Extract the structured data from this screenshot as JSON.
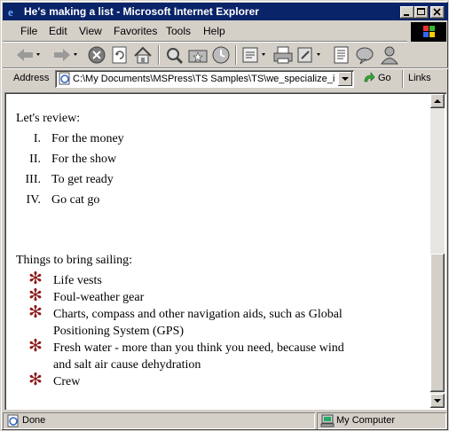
{
  "window": {
    "title": "He's making a list - Microsoft Internet Explorer"
  },
  "menu": [
    "File",
    "Edit",
    "View",
    "Favorites",
    "Tools",
    "Help"
  ],
  "address": {
    "label": "Address",
    "url": "C:\\My Documents\\MSPress\\TS Samples\\TS\\we_specialize_in",
    "go_label": "Go",
    "links_label": "Links"
  },
  "page": {
    "review_heading": "Let's review:",
    "review_items": [
      {
        "numeral": "I.",
        "text": "For the money"
      },
      {
        "numeral": "II.",
        "text": "For the show"
      },
      {
        "numeral": "III.",
        "text": "To get ready"
      },
      {
        "numeral": "IV.",
        "text": "Go cat go"
      }
    ],
    "sailing_heading": "Things to bring sailing:",
    "bullet_symbol": "✻",
    "sailing_items": [
      {
        "lines": [
          "Life vests"
        ]
      },
      {
        "lines": [
          "Foul-weather gear"
        ]
      },
      {
        "lines": [
          "Charts, compass and other navigation aids, such as Global",
          "Positioning System (GPS)"
        ]
      },
      {
        "lines": [
          "Fresh water - more than you think you need, because wind",
          "and salt air cause dehydration"
        ]
      },
      {
        "lines": [
          "Crew"
        ]
      }
    ]
  },
  "status": {
    "text": "Done",
    "zone": "My Computer"
  },
  "colors": {
    "titlebar": "#0a246a",
    "bullet": "#8b1a1a"
  }
}
